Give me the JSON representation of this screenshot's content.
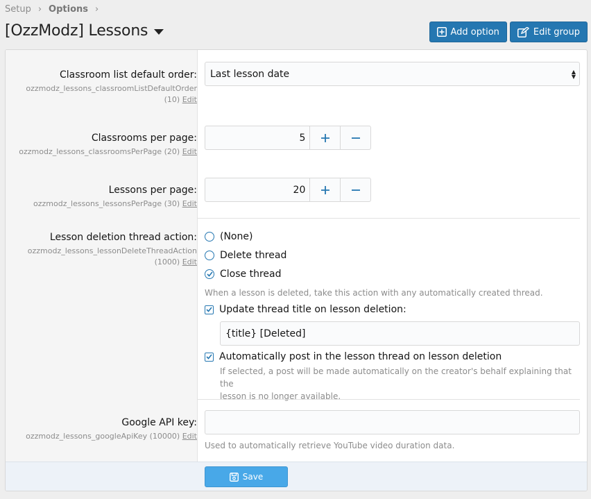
{
  "breadcrumb": {
    "items": [
      "Setup",
      "Options"
    ]
  },
  "page": {
    "title": "[OzzModz] Lessons"
  },
  "toolbar": {
    "add_option": "Add option",
    "edit_group": "Edit group"
  },
  "options": {
    "classroom_order": {
      "label": "Classroom list default order:",
      "id": "ozzmodz_lessons_classroomListDefaultOrder",
      "order": "(10)",
      "edit": "Edit",
      "value": "Last lesson date"
    },
    "classrooms_per_page": {
      "label": "Classrooms per page:",
      "id": "ozzmodz_lessons_classroomsPerPage (20)",
      "edit": "Edit",
      "value": "5"
    },
    "lessons_per_page": {
      "label": "Lessons per page:",
      "id": "ozzmodz_lessons_lessonsPerPage (30)",
      "edit": "Edit",
      "value": "20"
    },
    "delete_action": {
      "label": "Lesson deletion thread action:",
      "id": "ozzmodz_lessons_lessonDeleteThreadAction",
      "order": "(1000)",
      "edit": "Edit",
      "radios": [
        "(None)",
        "Delete thread",
        "Close thread"
      ],
      "selected": "Close thread",
      "explain": "When a lesson is deleted, take this action with any automatically created thread.",
      "update_title_label": "Update thread title on lesson deletion:",
      "update_title_checked": true,
      "title_value": "{title} [Deleted]",
      "autopost_label": "Automatically post in the lesson thread on lesson deletion",
      "autopost_checked": true,
      "autopost_explain_1": "If selected, a post will be made automatically on the creator's behalf explaining that the",
      "autopost_explain_2": "lesson is no longer available."
    },
    "google_api": {
      "label": "Google API key:",
      "id": "ozzmodz_lessons_googleApiKey (10000)",
      "edit": "Edit",
      "value": "",
      "explain": "Used to automatically retrieve YouTube video duration data."
    }
  },
  "footer": {
    "save": "Save"
  },
  "colors": {
    "accent": "#2577b1",
    "save": "#48a8e8"
  }
}
